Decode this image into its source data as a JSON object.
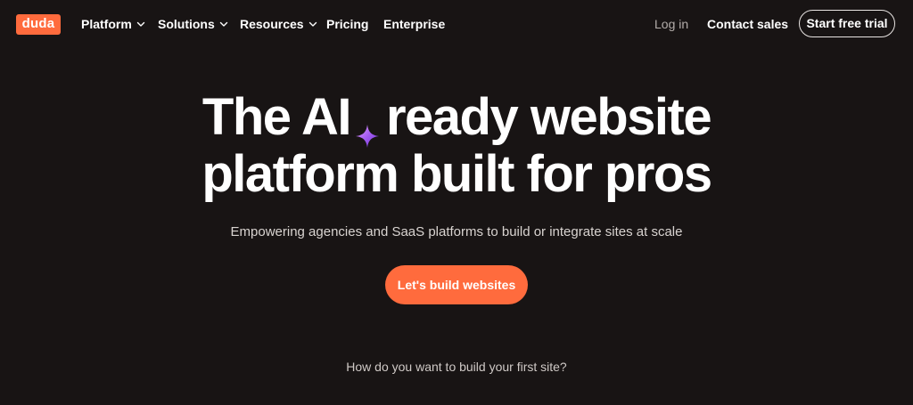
{
  "brand": {
    "logo_text": "duda",
    "accent_color": "#ff6b3d",
    "background_color": "#181414"
  },
  "nav": {
    "items": [
      {
        "label": "Platform",
        "has_dropdown": true
      },
      {
        "label": "Solutions",
        "has_dropdown": true
      },
      {
        "label": "Resources",
        "has_dropdown": true
      },
      {
        "label": "Pricing",
        "has_dropdown": false
      },
      {
        "label": "Enterprise",
        "has_dropdown": false
      }
    ],
    "login_label": "Log in",
    "contact_label": "Contact sales",
    "trial_label": "Start free trial"
  },
  "hero": {
    "headline_part1": "The AI",
    "headline_part2": "ready website",
    "headline_line2": "platform built for pros",
    "sparkle_icon": "sparkle-icon",
    "subheadline": "Empowering agencies and SaaS platforms to build or integrate sites at scale",
    "cta_label": "Let's build websites",
    "question": "How do you want to build your first site?"
  }
}
